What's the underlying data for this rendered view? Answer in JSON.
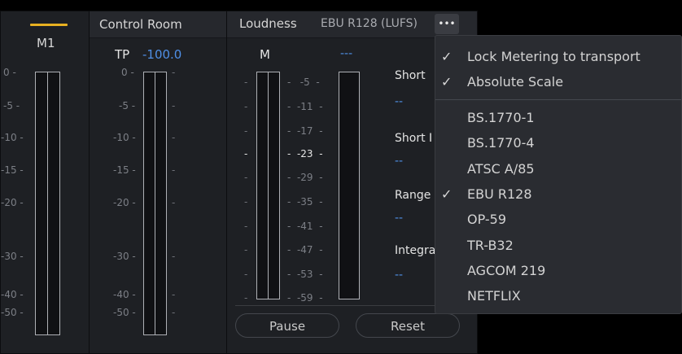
{
  "channel": {
    "label": "M1",
    "ticks": [
      "0 -",
      "-5 -",
      "-10 -",
      "-15 -",
      "-20 -",
      "-30 -",
      "-40 -",
      "-50 -"
    ]
  },
  "control_room": {
    "title": "Control Room",
    "tp_label": "TP",
    "tp_value": "-100.0",
    "ticks": [
      "0 -",
      "-5 -",
      "-10 -",
      "-15 -",
      "-20 -",
      "-30 -",
      "-40 -",
      "-50 -"
    ]
  },
  "loudness": {
    "title": "Loudness",
    "standard": "EBU R128 (LUFS)",
    "more_label": "•••",
    "m_label": "M",
    "m_value": "---",
    "scale": [
      "-5",
      "-11",
      "-17",
      "-23",
      "-29",
      "-35",
      "-41",
      "-47",
      "-53",
      "-59"
    ],
    "stats": [
      {
        "label": "Short",
        "value": "--"
      },
      {
        "label": "Short I",
        "value": "--"
      },
      {
        "label": "Range",
        "value": "--"
      },
      {
        "label": "Integra",
        "value": "--"
      }
    ],
    "pause_label": "Pause",
    "reset_label": "Reset"
  },
  "menu": {
    "check_glyph": "✓",
    "options": [
      {
        "label": "Lock Metering to transport",
        "checked": true
      },
      {
        "label": "Absolute Scale",
        "checked": true
      }
    ],
    "standards": [
      {
        "label": "BS.1770-1",
        "checked": false
      },
      {
        "label": "BS.1770-4",
        "checked": false
      },
      {
        "label": "ATSC A/85",
        "checked": false
      },
      {
        "label": "EBU R128",
        "checked": true
      },
      {
        "label": "OP-59",
        "checked": false
      },
      {
        "label": "TR-B32",
        "checked": false
      },
      {
        "label": "AGCOM 219",
        "checked": false
      },
      {
        "label": "NETFLIX",
        "checked": false
      }
    ]
  },
  "colors": {
    "accent": "#e8b021",
    "value_blue": "#4f8fe6",
    "panel": "#1e2024",
    "menu": "#2a2c31"
  }
}
